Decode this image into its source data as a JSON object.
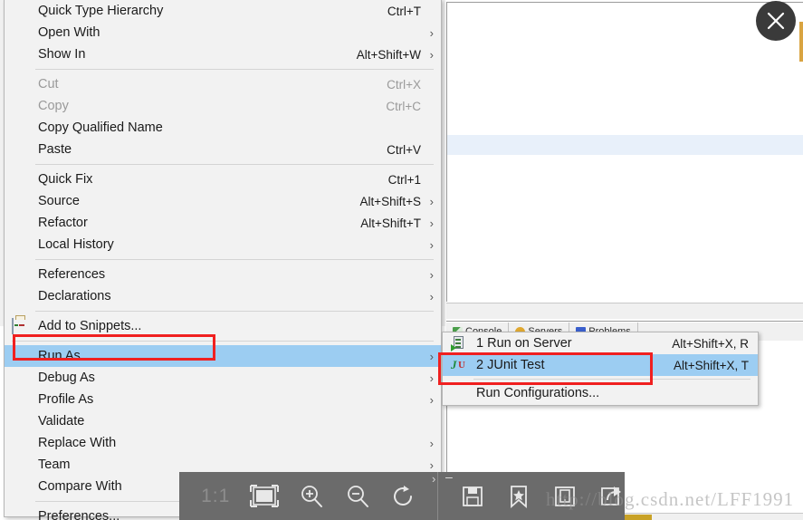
{
  "window": {
    "close_button_icon": "close-icon"
  },
  "editor": {
    "tabs": [
      {
        "label": "Console",
        "icon": "console-icon"
      },
      {
        "label": "Servers",
        "icon": "servers-icon"
      },
      {
        "label": "Problems",
        "icon": "problems-icon"
      }
    ]
  },
  "context_menu": {
    "items": [
      {
        "label": "Quick Type Hierarchy",
        "accel": "Ctrl+T",
        "arrow": false,
        "disabled": false,
        "icon": null
      },
      {
        "label": "Open With",
        "accel": "",
        "arrow": true,
        "disabled": false,
        "icon": null
      },
      {
        "label": "Show In",
        "accel": "Alt+Shift+W",
        "arrow": true,
        "disabled": false,
        "icon": null
      },
      {
        "separator": true
      },
      {
        "label": "Cut",
        "accel": "Ctrl+X",
        "arrow": false,
        "disabled": true,
        "icon": null
      },
      {
        "label": "Copy",
        "accel": "Ctrl+C",
        "arrow": false,
        "disabled": true,
        "icon": null
      },
      {
        "label": "Copy Qualified Name",
        "accel": "",
        "arrow": false,
        "disabled": false,
        "icon": null
      },
      {
        "label": "Paste",
        "accel": "Ctrl+V",
        "arrow": false,
        "disabled": false,
        "icon": null
      },
      {
        "separator": true
      },
      {
        "label": "Quick Fix",
        "accel": "Ctrl+1",
        "arrow": false,
        "disabled": false,
        "icon": null
      },
      {
        "label": "Source",
        "accel": "Alt+Shift+S",
        "arrow": true,
        "disabled": false,
        "icon": null
      },
      {
        "label": "Refactor",
        "accel": "Alt+Shift+T",
        "arrow": true,
        "disabled": false,
        "icon": null
      },
      {
        "label": "Local History",
        "accel": "",
        "arrow": true,
        "disabled": false,
        "icon": null
      },
      {
        "separator": true
      },
      {
        "label": "References",
        "accel": "",
        "arrow": true,
        "disabled": false,
        "icon": null
      },
      {
        "label": "Declarations",
        "accel": "",
        "arrow": true,
        "disabled": false,
        "icon": null
      },
      {
        "separator": true
      },
      {
        "label": "Add to Snippets...",
        "accel": "",
        "arrow": false,
        "disabled": false,
        "icon": "snippets-icon"
      },
      {
        "separator": true
      },
      {
        "label": "Run As",
        "accel": "",
        "arrow": true,
        "disabled": false,
        "selected": true,
        "icon": null
      },
      {
        "label": "Debug As",
        "accel": "",
        "arrow": true,
        "disabled": false,
        "icon": null
      },
      {
        "label": "Profile As",
        "accel": "",
        "arrow": true,
        "disabled": false,
        "icon": null
      },
      {
        "label": "Validate",
        "accel": "",
        "arrow": false,
        "disabled": false,
        "icon": null
      },
      {
        "label": "Replace With",
        "accel": "",
        "arrow": true,
        "disabled": false,
        "icon": null
      },
      {
        "label": "Team",
        "accel": "",
        "arrow": true,
        "disabled": false,
        "icon": null
      },
      {
        "label": "Compare With",
        "accel": "",
        "arrow": true,
        "disabled": false,
        "icon": null
      },
      {
        "separator": true
      },
      {
        "label": "Preferences...",
        "accel": "",
        "arrow": false,
        "disabled": false,
        "icon": null
      }
    ]
  },
  "run_as_submenu": {
    "items": [
      {
        "label": "1 Run on Server",
        "accel": "Alt+Shift+X, R",
        "icon": "server-icon",
        "selected": false
      },
      {
        "label": "2 JUnit Test",
        "accel": "Alt+Shift+X, T",
        "icon": "junit-icon",
        "selected": true
      },
      {
        "separator": true
      },
      {
        "label": "Run Configurations...",
        "accel": "",
        "icon": null,
        "selected": false
      }
    ]
  },
  "annotations": {
    "highlight_color": "#f02020",
    "boxes": [
      {
        "target": "Run As"
      },
      {
        "target": "2 JUnit Test"
      }
    ]
  },
  "image_toolbar": {
    "zoom_ratio": "1:1",
    "buttons": [
      {
        "name": "fit-to-window-icon",
        "title": "Fit to window"
      },
      {
        "name": "zoom-in-icon",
        "title": "Zoom in"
      },
      {
        "name": "zoom-out-icon",
        "title": "Zoom out"
      },
      {
        "name": "rotate-icon",
        "title": "Rotate"
      },
      {
        "name": "save-icon",
        "title": "Save"
      },
      {
        "name": "favorite-icon",
        "title": "Favorite"
      },
      {
        "name": "device-icon",
        "title": "Send to device"
      },
      {
        "name": "share-icon",
        "title": "Share"
      }
    ]
  },
  "watermark": {
    "text": "http://blog.csdn.net/LFF1991"
  }
}
